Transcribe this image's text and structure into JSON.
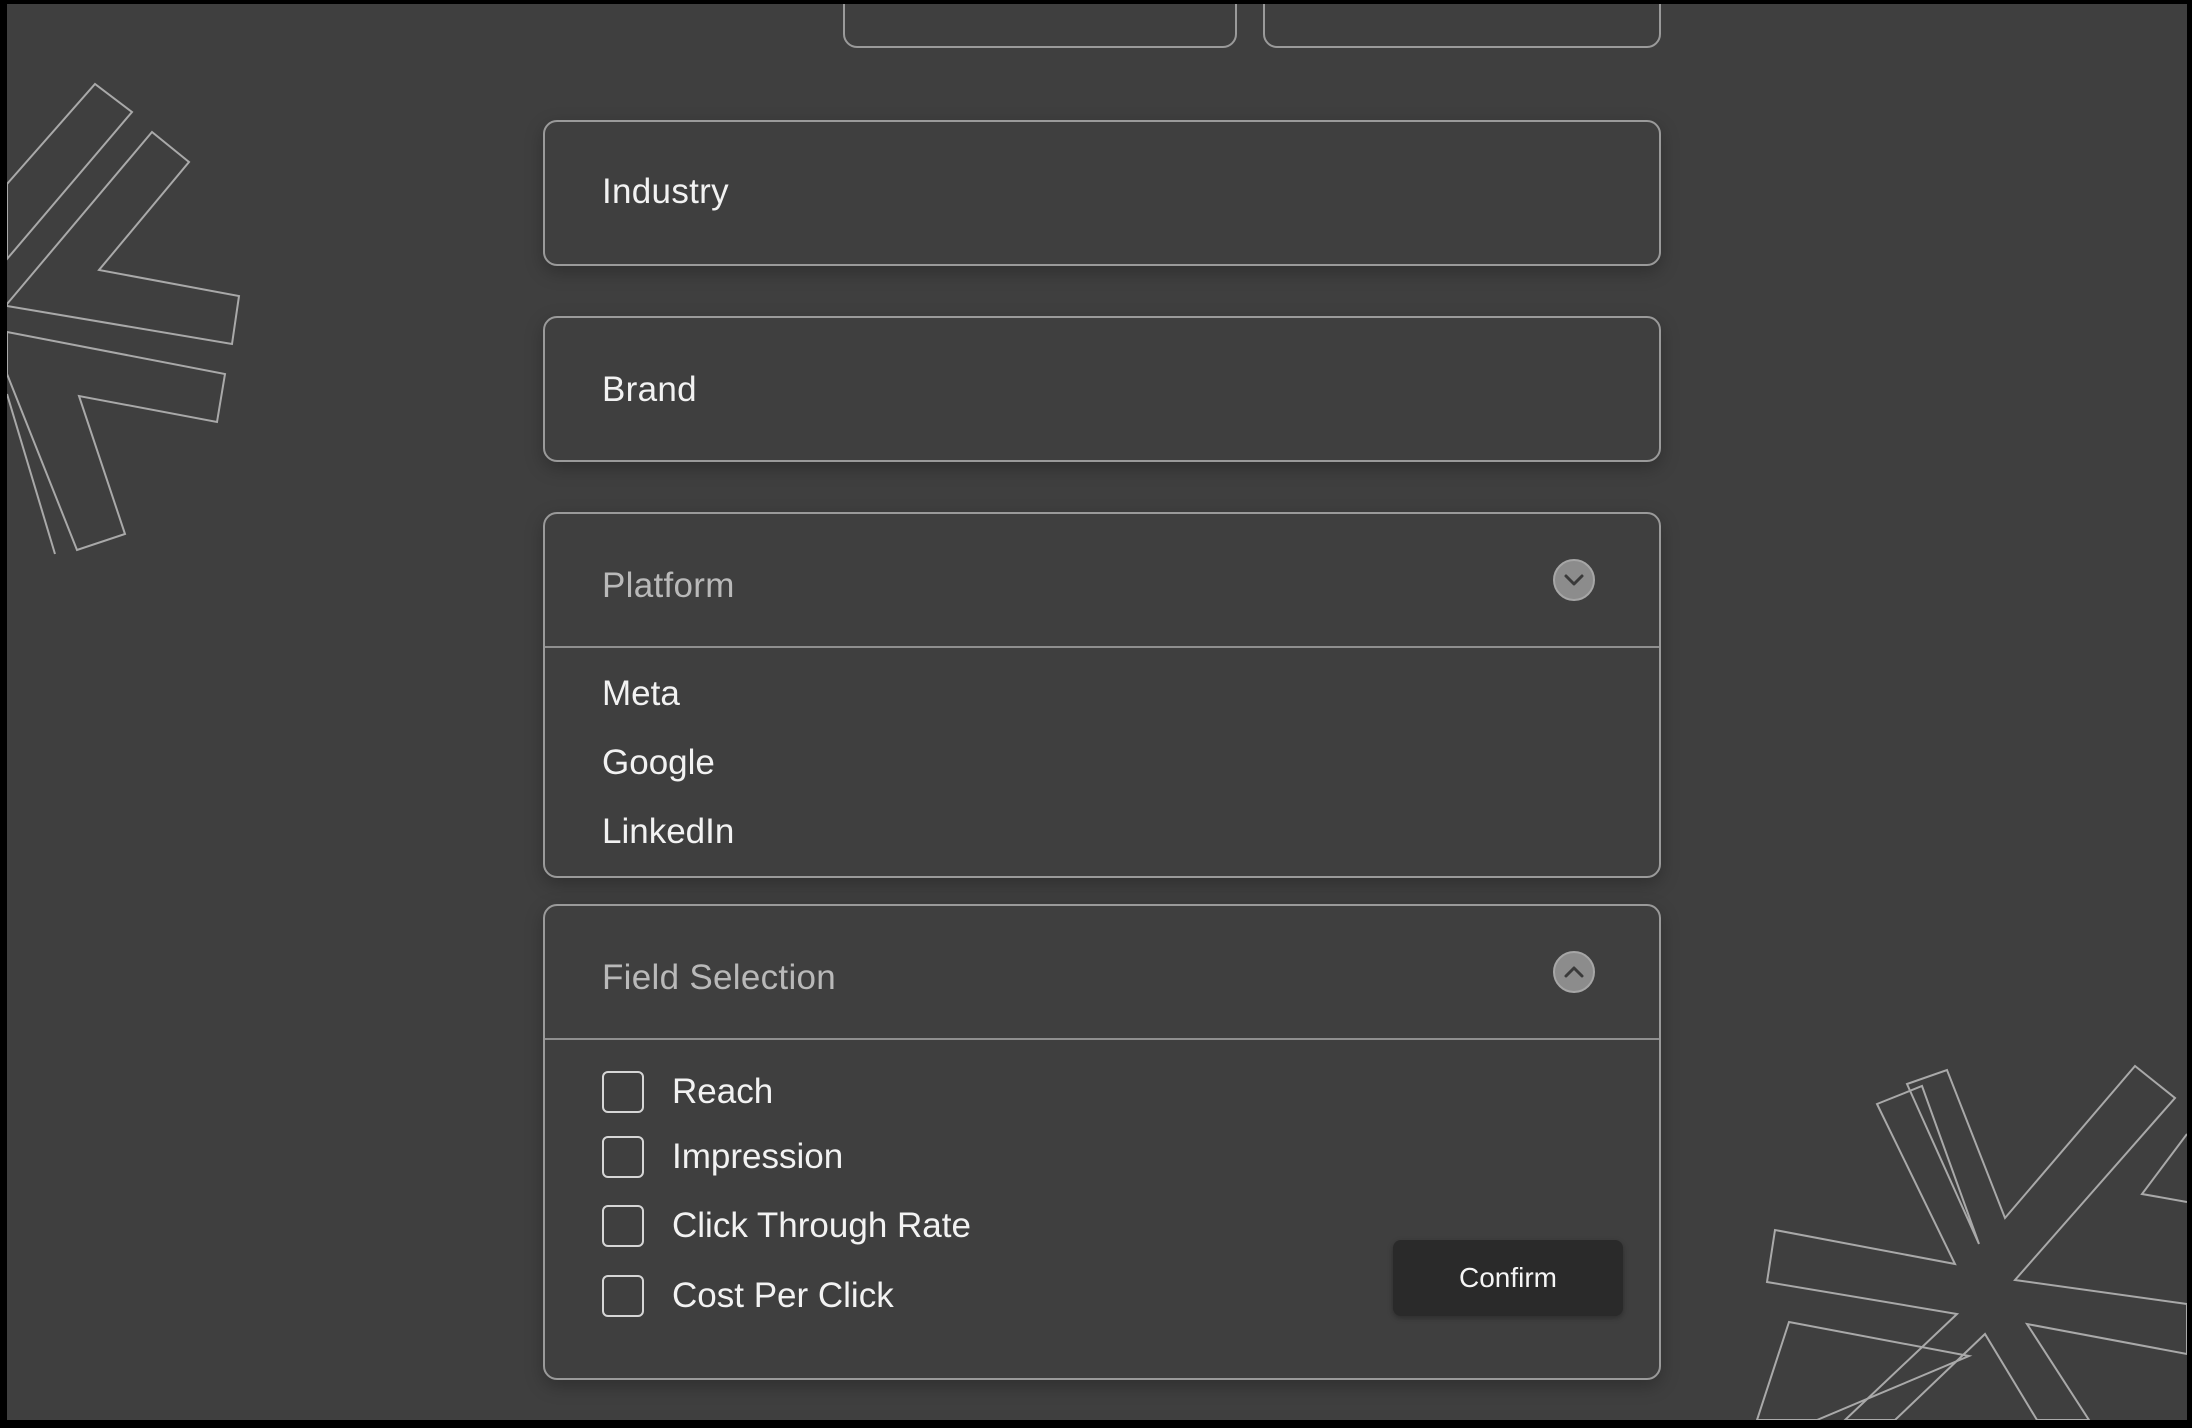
{
  "form": {
    "industry": {
      "label": "Industry"
    },
    "brand": {
      "label": "Brand"
    },
    "platform": {
      "placeholder": "Platform",
      "options": [
        "Meta",
        "Google",
        "LinkedIn"
      ]
    },
    "field_selection": {
      "placeholder": "Field Selection",
      "fields": [
        {
          "label": "Reach",
          "checked": false
        },
        {
          "label": "Impression",
          "checked": false
        },
        {
          "label": "Click Through Rate",
          "checked": false
        },
        {
          "label": "Cost Per Click",
          "checked": false
        }
      ],
      "confirm_label": "Confirm"
    }
  },
  "icons": {
    "platform_toggle": "chevron-down-icon",
    "field_toggle": "chevron-up-icon"
  },
  "colors": {
    "background": "#3f3f3f",
    "border": "#9a9a9a",
    "confirm_bg": "#2a2a2a",
    "text": "#f2f2f2"
  }
}
